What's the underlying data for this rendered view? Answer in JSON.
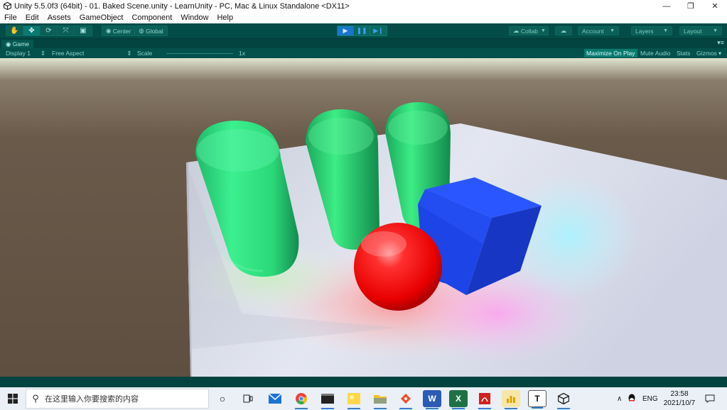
{
  "window": {
    "title": "Unity 5.5.0f3 (64bit) - 01. Baked Scene.unity - LearnUnity - PC, Mac & Linux Standalone <DX11>",
    "minimize": "—",
    "maximize": "❐",
    "close": "✕"
  },
  "menu": [
    "File",
    "Edit",
    "Assets",
    "GameObject",
    "Component",
    "Window",
    "Help"
  ],
  "toolbar": {
    "pivot_center": "Center",
    "pivot_global": "Global",
    "collab": "Collab",
    "account": "Account",
    "layers": "Layers",
    "layout": "Layout"
  },
  "game_tab": {
    "label": "Game",
    "display": "Display 1",
    "aspect": "Free Aspect",
    "scale_label": "Scale",
    "scale_value": "1x",
    "maximize_on_play": "Maximize On Play",
    "mute_audio": "Mute Audio",
    "stats": "Stats",
    "gizmos": "Gizmos"
  },
  "colors": {
    "editor_tint": "#044c47",
    "floor": "#dfe3ee",
    "capsule": "#2ee08a",
    "sphere": "#ff1414",
    "cube": "#1d44e6"
  },
  "taskbar": {
    "search_placeholder": "在这里输入你要搜索的内容",
    "apps": [
      "task-view",
      "cortana",
      "mail",
      "chrome",
      "terminal",
      "photos",
      "file-explorer",
      "git",
      "word",
      "excel",
      "acrobat",
      "profiler",
      "typora",
      "unity"
    ],
    "word_label": "W",
    "excel_label": "X",
    "typora_label": "T",
    "language": "ENG",
    "time": "23:58",
    "date": "2021/10/7"
  }
}
